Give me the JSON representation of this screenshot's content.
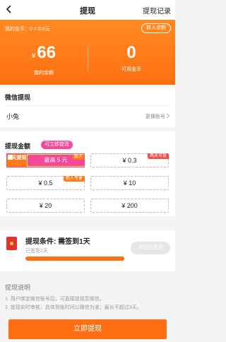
{
  "navbar": {
    "title": "提现",
    "record_label": "提现记录"
  },
  "banner": {
    "coins_text": "我的金币：0 = 0.0元",
    "to_balance_label": "转入余额",
    "currency_symbol": "¥",
    "balance_value": "66",
    "balance_label": "我的余额",
    "coins_value": "0",
    "coins_label": "可用金币"
  },
  "wechat": {
    "title": "微信提现",
    "account_name": "小兔",
    "change_account_label": "更换账号"
  },
  "amounts": {
    "title": "提现金额",
    "promo": {
      "bubble": "可立即提现",
      "days_text": "1天提现",
      "label": "最高 5 元",
      "corner_tag": "新人"
    },
    "options": [
      {
        "label": "¥ 0.3",
        "tag": "两天可提"
      },
      {
        "label": "¥ 0.5",
        "tag": "新人专享"
      },
      {
        "label": "¥ 10",
        "tag": ""
      },
      {
        "label": "¥ 20",
        "tag": ""
      },
      {
        "label": "¥ 200",
        "tag": ""
      }
    ]
  },
  "condition": {
    "title": "提现条件: 需签到1天",
    "subtitle": "已签到1天",
    "progress": 1.0,
    "button_label": "本日已签到"
  },
  "notes": {
    "title": "提现说明",
    "lines": [
      "1. 用户绑定微信账号后，可直接提现至微信。",
      "2. 提现实时审核，具体到账时间以微信为准；最长不超过3天。"
    ]
  },
  "withdraw_button": "立即提现",
  "colors": {
    "accent": "#ff6f12",
    "pink": "#f7479a",
    "yellow": "#ffe45e"
  }
}
